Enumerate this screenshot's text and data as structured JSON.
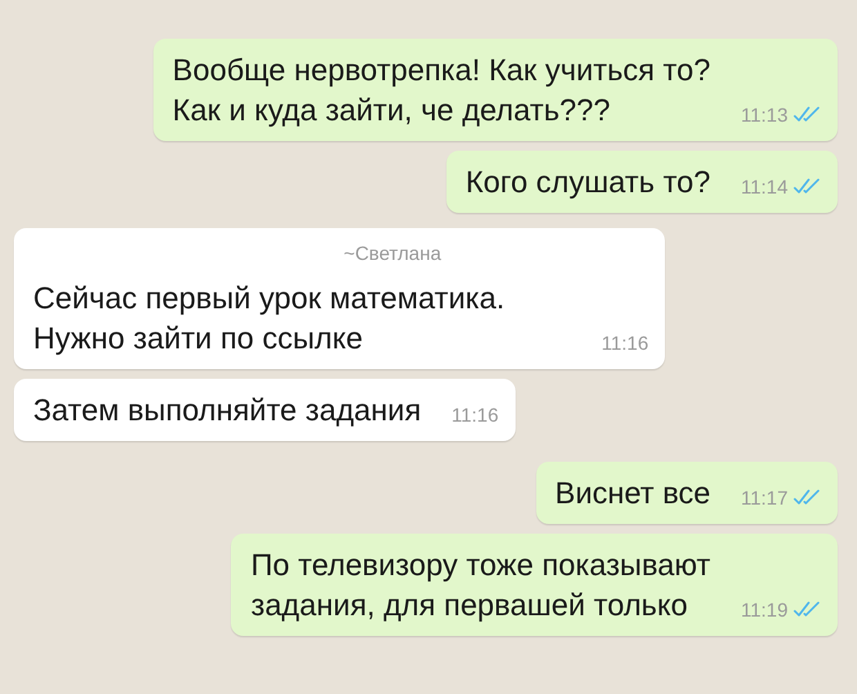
{
  "messages": [
    {
      "kind": "outgoing",
      "lines": [
        "Вообще нервотрепка! Как учиться то?",
        "Как и куда зайти, че делать???"
      ],
      "time": "11:13",
      "read": true
    },
    {
      "kind": "outgoing",
      "lines": [
        "Кого слушать то?"
      ],
      "time": "11:14",
      "read": true
    },
    {
      "kind": "incoming",
      "sender": "~Светлана",
      "lines": [
        "Сейчас первый урок математика.",
        "Нужно зайти по ссылке"
      ],
      "time": "11:16"
    },
    {
      "kind": "incoming",
      "lines": [
        "Затем выполняйте задания"
      ],
      "time": "11:16"
    },
    {
      "kind": "outgoing",
      "lines": [
        "Виснет все"
      ],
      "time": "11:17",
      "read": true
    },
    {
      "kind": "outgoing",
      "lines": [
        "По телевизору тоже показывают",
        "задания, для первашей только"
      ],
      "time": "11:19",
      "read": true
    }
  ]
}
